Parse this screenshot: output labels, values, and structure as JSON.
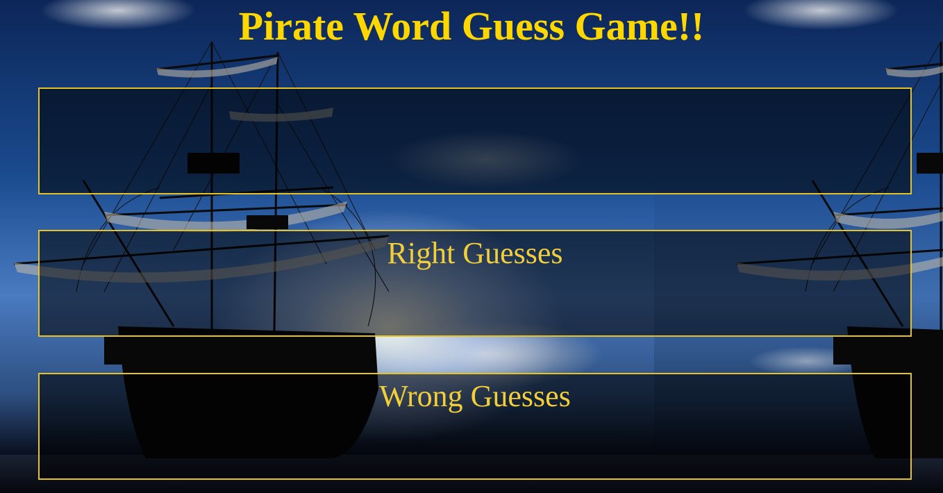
{
  "game": {
    "title": "Pirate Word Guess Game!!"
  },
  "panels": {
    "word": {
      "text": ""
    },
    "right": {
      "heading": "Right Guesses",
      "items": ""
    },
    "wrong": {
      "heading": "Wrong Guesses",
      "items": ""
    }
  },
  "colors": {
    "title": "#ffd700",
    "panel_border": "#e6c229",
    "panel_text": "#f2cf3a"
  },
  "icons": {
    "background": "pirate-ship-background"
  }
}
